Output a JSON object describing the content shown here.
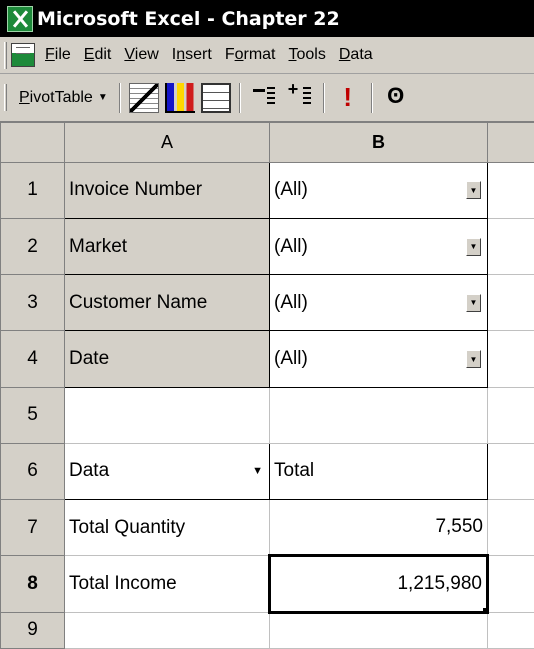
{
  "window": {
    "title": "Microsoft Excel - Chapter 22"
  },
  "menu": {
    "items": [
      {
        "label": "File",
        "accel": "F",
        "rest": "ile"
      },
      {
        "label": "Edit",
        "accel": "E",
        "rest": "dit"
      },
      {
        "label": "View",
        "accel": "V",
        "rest": "iew"
      },
      {
        "label": "Insert",
        "pre": "I",
        "accel": "n",
        "rest": "sert"
      },
      {
        "label": "Format",
        "pre": "F",
        "accel": "o",
        "rest": "rmat"
      },
      {
        "label": "Tools",
        "accel": "T",
        "rest": "ools"
      },
      {
        "label": "Data",
        "accel": "D",
        "rest": "ata"
      }
    ]
  },
  "toolbar": {
    "pivot_button": {
      "accel": "P",
      "rest": "ivotTable"
    },
    "icons": [
      "pivot-wizard-icon",
      "pivot-chart-icon",
      "pivot-table-icon",
      "hide-detail-icon",
      "show-detail-icon",
      "refresh-data-icon",
      "more-icon"
    ]
  },
  "sheet": {
    "columns": [
      "A",
      "B"
    ],
    "active_column": "B",
    "active_row": "8",
    "rows": [
      {
        "num": "1",
        "a": "Invoice Number",
        "b": "(All)"
      },
      {
        "num": "2",
        "a": "Market",
        "b": "(All)"
      },
      {
        "num": "3",
        "a": "Customer Name",
        "b": "(All)"
      },
      {
        "num": "4",
        "a": "Date",
        "b": "(All)"
      },
      {
        "num": "5",
        "a": "",
        "b": ""
      },
      {
        "num": "6",
        "a": "Data",
        "b": "Total"
      },
      {
        "num": "7",
        "a": "Total Quantity",
        "b": "7,550"
      },
      {
        "num": "8",
        "a": "Total Income",
        "b": "1,215,980"
      },
      {
        "num": "9",
        "a": "",
        "b": ""
      }
    ]
  }
}
